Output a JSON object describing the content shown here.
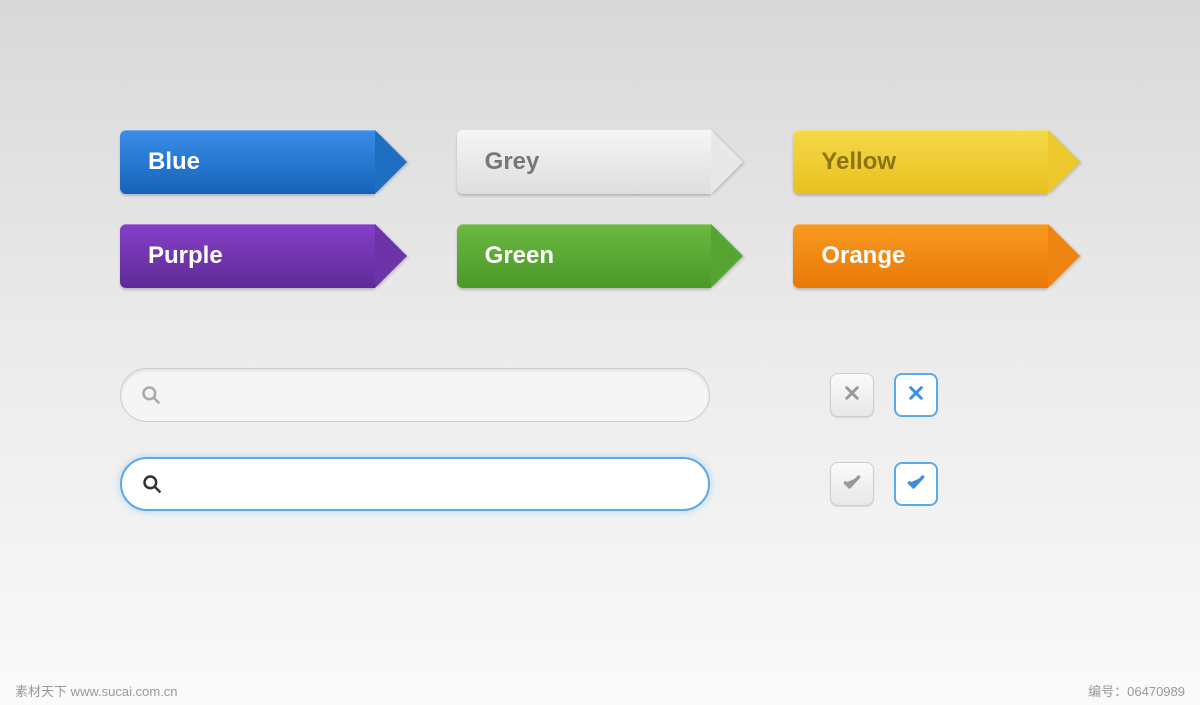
{
  "buttons": [
    {
      "label": "Blue",
      "class": "blue"
    },
    {
      "label": "Grey",
      "class": "grey"
    },
    {
      "label": "Yellow",
      "class": "yellow"
    },
    {
      "label": "Purple",
      "class": "purple"
    },
    {
      "label": "Green",
      "class": "green"
    },
    {
      "label": "Orange",
      "class": "orange"
    }
  ],
  "search": {
    "placeholder_default": "",
    "placeholder_active": ""
  },
  "footer": {
    "left": "素材天下 www.sucai.com.cn",
    "right_label": "编号：",
    "right_value": "06470989"
  },
  "colors": {
    "blue": "#1e6ec2",
    "grey": "#e8e8e8",
    "yellow": "#edc82c",
    "purple": "#6e33a8",
    "green": "#56a432",
    "orange": "#ee8510",
    "accent": "#5aa9e8"
  }
}
